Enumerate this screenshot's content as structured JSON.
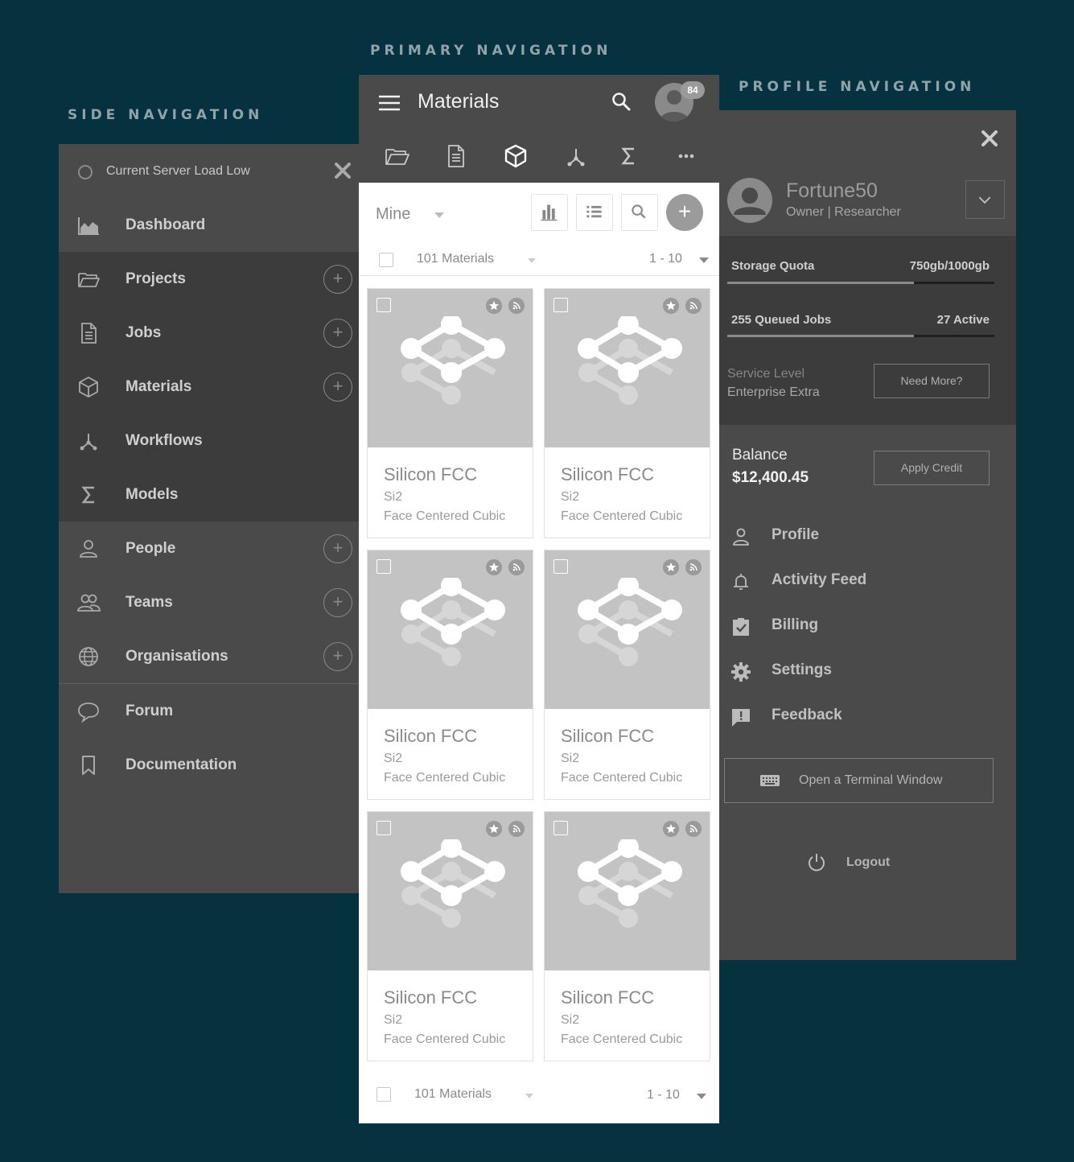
{
  "titles": {
    "side_nav": "SIDE NAVIGATION",
    "primary_nav": "PRIMARY NAVIGATION",
    "profile_nav": "PROFILE NAVIGATION"
  },
  "side_nav": {
    "status": "Current Server Load Low",
    "items": [
      {
        "label": "Dashboard",
        "icon": "area-chart-icon"
      },
      {
        "label": "Projects",
        "icon": "folder-icon"
      },
      {
        "label": "Jobs",
        "icon": "document-icon"
      },
      {
        "label": "Materials",
        "icon": "cube-icon"
      },
      {
        "label": "Workflows",
        "icon": "workflow-icon"
      },
      {
        "label": "Models",
        "icon": "sigma-icon"
      },
      {
        "label": "People",
        "icon": "person-icon"
      },
      {
        "label": "Teams",
        "icon": "team-icon"
      },
      {
        "label": "Organisations",
        "icon": "globe-icon"
      },
      {
        "label": "Forum",
        "icon": "speech-bubble-icon"
      },
      {
        "label": "Documentation",
        "icon": "bookmark-icon"
      }
    ]
  },
  "primary_nav": {
    "title": "Materials",
    "notification_count": "84",
    "filter": "Mine",
    "list_count": "101 Materials",
    "page_range": "1 - 10",
    "cards": [
      {
        "name": "Silicon FCC",
        "formula": "Si2",
        "desc": "Face Centered Cubic"
      },
      {
        "name": "Silicon FCC",
        "formula": "Si2",
        "desc": "Face Centered Cubic"
      },
      {
        "name": "Silicon FCC",
        "formula": "Si2",
        "desc": "Face Centered Cubic"
      },
      {
        "name": "Silicon FCC",
        "formula": "Si2",
        "desc": "Face Centered Cubic"
      },
      {
        "name": "Silicon FCC",
        "formula": "Si2",
        "desc": "Face Centered Cubic"
      },
      {
        "name": "Silicon FCC",
        "formula": "Si2",
        "desc": "Face Centered Cubic"
      }
    ]
  },
  "profile_nav": {
    "username": "Fortune50",
    "role": "Owner | Researcher",
    "storage_label": "Storage Quota",
    "storage_value": "750gb/1000gb",
    "storage_fraction": 0.7,
    "jobs_label": "255 Queued Jobs",
    "jobs_value": "27 Active",
    "jobs_fraction": 0.7,
    "service_label": "Service Level",
    "service_value": "Enterprise Extra",
    "need_more": "Need More?",
    "balance_label": "Balance",
    "balance_value": "$12,400.45",
    "apply_credit": "Apply Credit",
    "menu": [
      {
        "label": "Profile",
        "icon": "person-icon"
      },
      {
        "label": "Activity Feed",
        "icon": "bell-icon"
      },
      {
        "label": "Billing",
        "icon": "clipboard-check-icon"
      },
      {
        "label": "Settings",
        "icon": "gear-icon"
      },
      {
        "label": "Feedback",
        "icon": "feedback-icon"
      }
    ],
    "terminal": "Open a Terminal Window",
    "logout": "Logout"
  },
  "colors": {
    "background": "#06323f",
    "panel": "#4a4a4a",
    "panel_dark": "#3c3c3c",
    "thumb": "#c3c3c3"
  }
}
